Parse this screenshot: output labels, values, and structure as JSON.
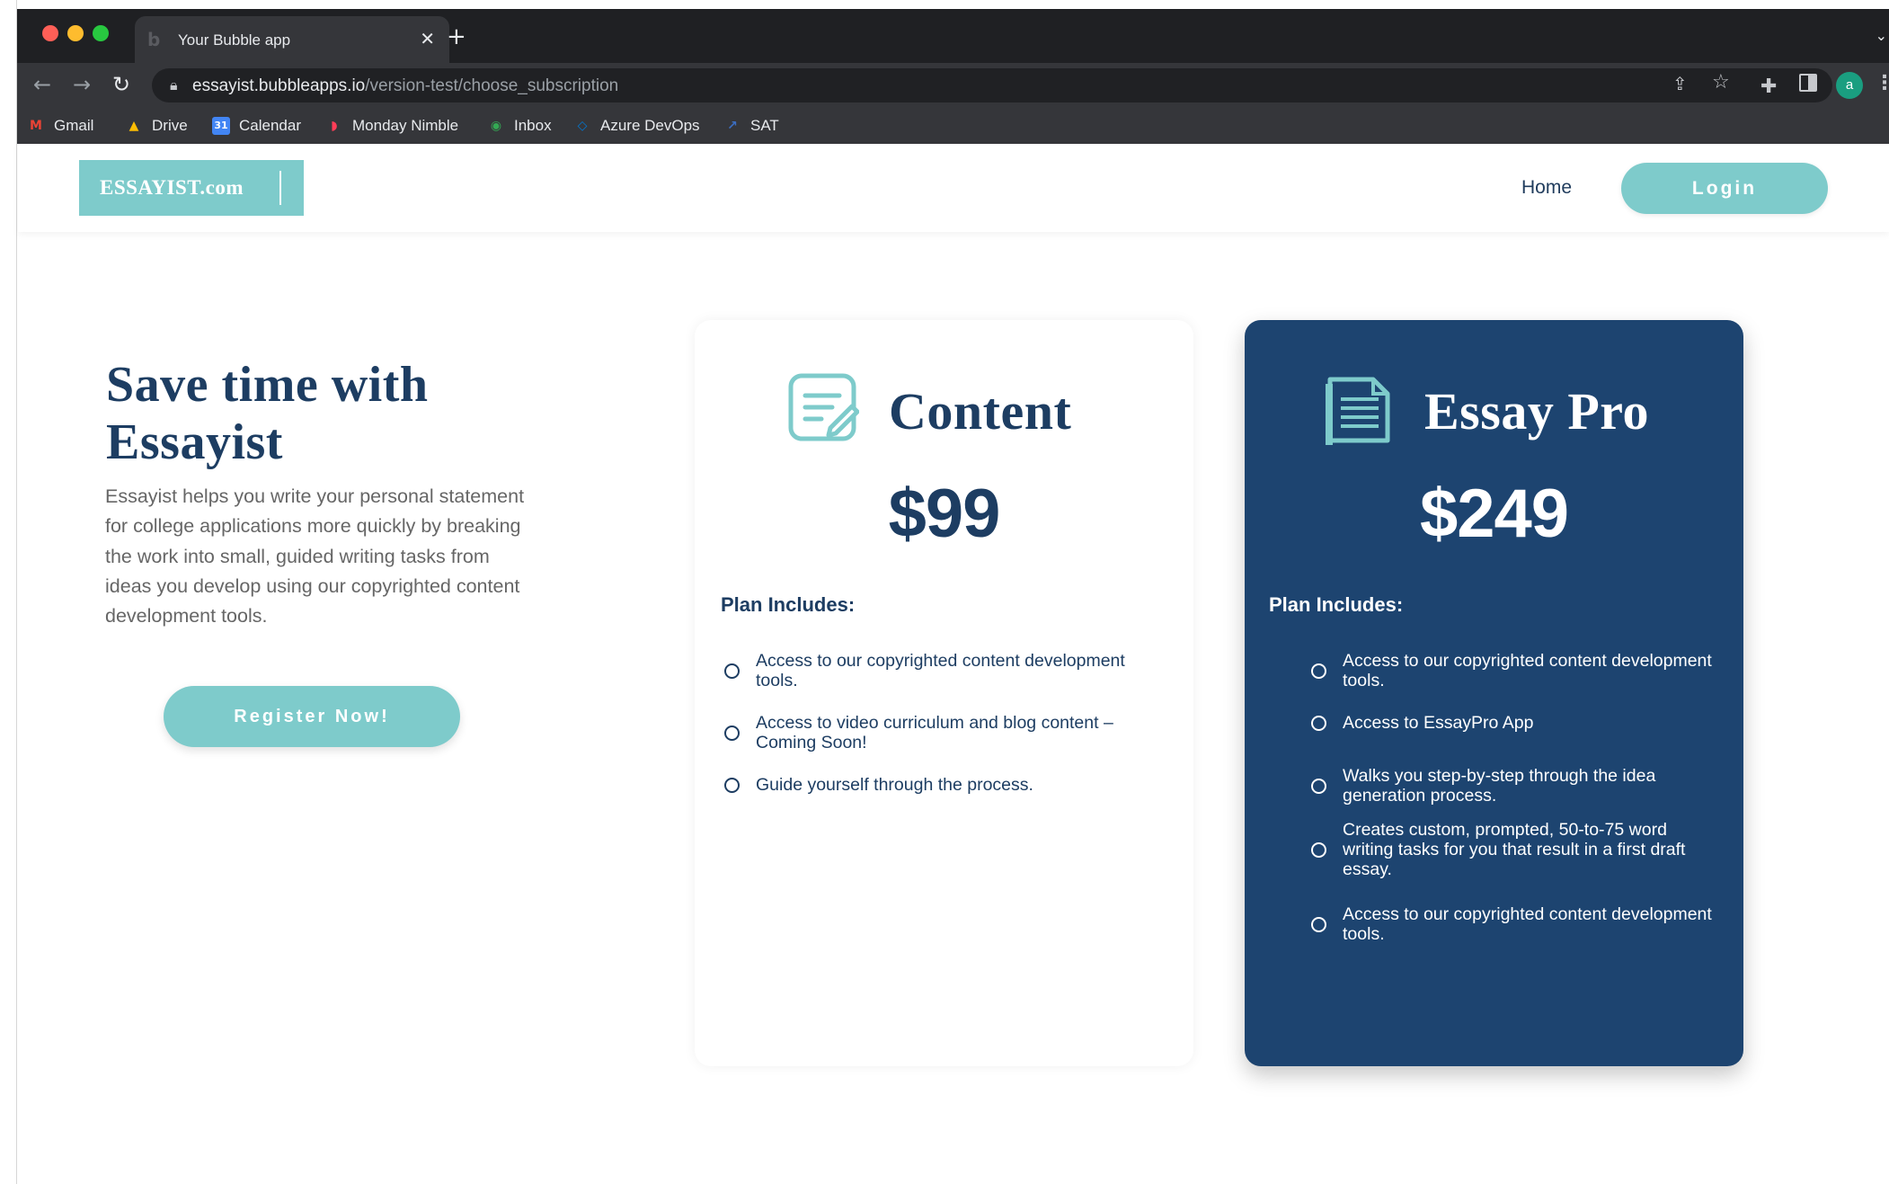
{
  "browser": {
    "tab_title": "Your Bubble app",
    "url_host": "essayist.bubbleapps.io",
    "url_path": "/version-test/choose_subscription",
    "profile_initial": "a",
    "bookmarks": [
      {
        "label": "Gmail",
        "icon": "gmail-icon"
      },
      {
        "label": "Drive",
        "icon": "drive-icon"
      },
      {
        "label": "Calendar",
        "icon": "calendar-icon"
      },
      {
        "label": "Monday Nimble",
        "icon": "monday-icon"
      },
      {
        "label": "Inbox",
        "icon": "inbox-icon"
      },
      {
        "label": "Azure DevOps",
        "icon": "azure-devops-icon"
      },
      {
        "label": "SAT",
        "icon": "sat-icon"
      }
    ]
  },
  "header": {
    "logo_text": "ESSAYIST.com",
    "nav_home": "Home",
    "login_label": "Login"
  },
  "hero": {
    "title": "Save time with Essayist",
    "description": "Essayist helps you write your personal statement for college applications more quickly by breaking the work into small, guided writing tasks from ideas you develop using our copyrighted content development tools.",
    "register_label": "Register Now!"
  },
  "plans": [
    {
      "name": "Content",
      "price": "$99",
      "includes_label": "Plan Includes:",
      "features": [
        "Access to our copyrighted content development tools.",
        "Access to video curriculum and blog content – Coming Soon!",
        "Guide yourself through the process."
      ]
    },
    {
      "name": "Essay Pro",
      "price": "$249",
      "includes_label": "Plan Includes:",
      "features": [
        "Access to our copyrighted content development tools.",
        "Access to EssayPro App",
        "Walks you step-by-step through the idea generation process.",
        "Creates custom, prompted, 50-to-75 word writing tasks for you that result in a first draft essay.",
        "Access to our copyrighted content development tools."
      ]
    }
  ],
  "colors": {
    "accent_teal": "#7ecbcb",
    "navy": "#1d4470",
    "heading_navy": "#1d3d62",
    "body_gray": "#666666"
  }
}
